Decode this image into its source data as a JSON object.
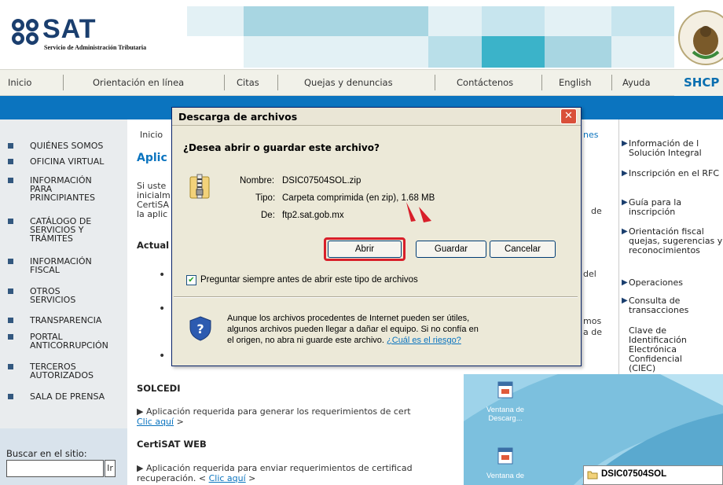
{
  "header": {
    "logo_text": "SAT",
    "logo_subtitle": "Servicio de Administración Tributaria"
  },
  "nav": {
    "items": [
      "Inicio",
      "Orientación en línea",
      "Citas",
      "Quejas y denuncias",
      "Contáctenos",
      "English",
      "Ayuda"
    ],
    "shcp": "SHCP"
  },
  "left_menu": [
    {
      "label": "QUIÉNES SOMOS"
    },
    {
      "label": "OFICINA VIRTUAL"
    },
    {
      "label": "INFORMACIÓN PARA PRINCIPIANTES"
    },
    {
      "label": "CATÁLOGO DE SERVICIOS Y TRÁMITES"
    },
    {
      "label": "INFORMACIÓN FISCAL"
    },
    {
      "label": "OTROS SERVICIOS"
    },
    {
      "label": "TRANSPARENCIA"
    },
    {
      "label": "PORTAL ANTICORRUPCIÓN"
    },
    {
      "label": "TERCEROS AUTORIZADOS"
    },
    {
      "label": "SALA DE PRENSA"
    }
  ],
  "search": {
    "label": "Buscar en el sitio:",
    "button": "Ir"
  },
  "main": {
    "breadcrumb": "Inicio",
    "breadcrumb_tail": "nes",
    "title": "Aplic",
    "intro_lines": [
      "Si uste",
      "inicialm",
      "CertiSA",
      "la aplic"
    ],
    "intro_right": "de",
    "subheading": "Actual",
    "right_frag_1": "del",
    "right_frag_2": "mos",
    "right_frag_3": "a de",
    "solcedi_heading": "SOLCEDI",
    "solcedi_text": "▶ Aplicación requerida para generar los requerimientos de cert",
    "solcedi_link": "Clic aquí",
    "solcedi_link_after": " >",
    "certisat_heading": "CertiSAT WEB",
    "certisat_text": "▶ Aplicación requerida para enviar requerimientos de certificad",
    "certisat_line2_before": "recuperación. < ",
    "certisat_link": "Clic aquí",
    "certisat_link_after": " >"
  },
  "right_column": [
    {
      "label": "Información de l Solución Integral"
    },
    {
      "label": "Inscripción en el RFC"
    },
    {
      "label": "Guía para la inscripción"
    },
    {
      "label": "Orientación fiscal quejas, sugerencias y reconocimientos"
    },
    {
      "label": "Operaciones"
    },
    {
      "label": "Consulta de transacciones"
    },
    {
      "label": "Clave de Identificación Electrónica Confidencial (CIEC)"
    }
  ],
  "dialog": {
    "title": "Descarga de archivos",
    "close": "✕",
    "question": "¿Desea abrir o guardar este archivo?",
    "name_label": "Nombre:",
    "name_value": "DSIC07504SOL.zip",
    "type_label": "Tipo:",
    "type_value": "Carpeta comprimida (en zip), 1.68 MB",
    "from_label": "De:",
    "from_value": "ftp2.sat.gob.mx",
    "open_button": "Abrir",
    "save_button": "Guardar",
    "cancel_button": "Cancelar",
    "always_ask": "Preguntar siempre antes de abrir este tipo de archivos",
    "warning_lines": [
      "Aunque los archivos procedentes de Internet pueden ser útiles,",
      "algunos archivos pueden llegar a dañar el equipo. Si no confía en",
      "el origen, no abra ni guarde este archivo. "
    ],
    "risk_link": "¿Cuál es el riesgo?"
  },
  "desktop": {
    "icon1_label": "Ventana de Descarg...",
    "icon2_label": "Ventana de",
    "task_item": "DSIC07504SOL"
  },
  "colors": {
    "blue_bar": "#0b74bf",
    "accent_red": "#d81f2a",
    "sat_blue": "#1a3e6e"
  }
}
